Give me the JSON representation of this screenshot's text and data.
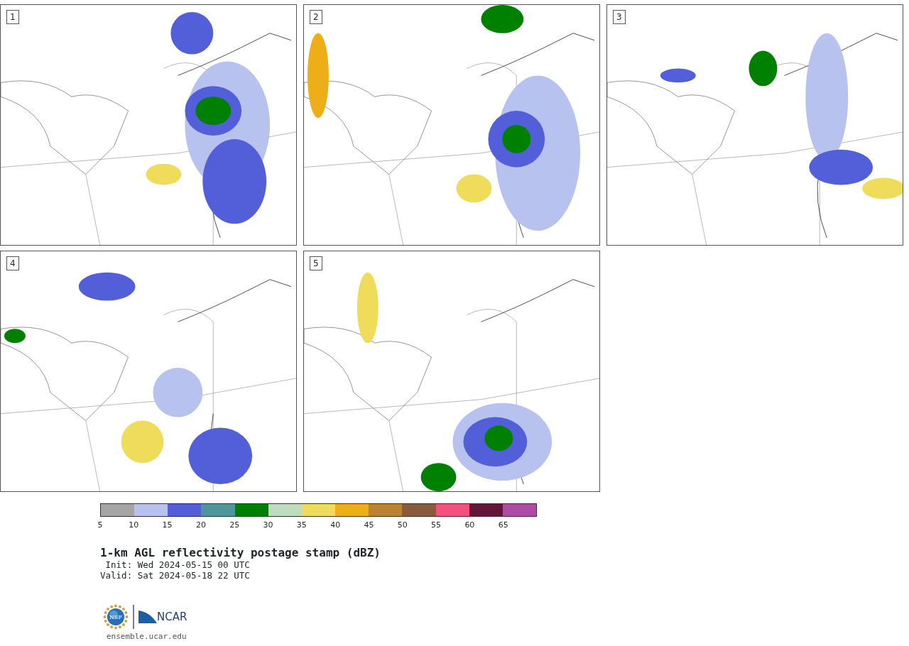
{
  "panels": [
    {
      "number": "1",
      "kind": "map-picture"
    },
    {
      "number": "2",
      "kind": "map-picture"
    },
    {
      "number": "3",
      "kind": "map-picture"
    },
    {
      "number": "4",
      "kind": "map-picture"
    },
    {
      "number": "5",
      "kind": "map-picture"
    }
  ],
  "colorbar": {
    "bins": [
      {
        "color": "#a5a5a5"
      },
      {
        "color": "#b8c2ee"
      },
      {
        "color": "#525fd8"
      },
      {
        "color": "#4f969c"
      },
      {
        "color": "#008000"
      },
      {
        "color": "#bfdcbe"
      },
      {
        "color": "#eedc5a"
      },
      {
        "color": "#eeae17"
      },
      {
        "color": "#bb8330"
      },
      {
        "color": "#8a5a3c"
      },
      {
        "color": "#f5507d"
      },
      {
        "color": "#62173a"
      },
      {
        "color": "#ae4ba7"
      }
    ],
    "ticks": [
      "5",
      "10",
      "15",
      "20",
      "25",
      "30",
      "35",
      "40",
      "45",
      "50",
      "55",
      "60",
      "65"
    ]
  },
  "title": "1-km AGL reflectivity postage stamp (dBZ)",
  "init": " Init: Wed 2024-05-15 00 UTC",
  "valid": "Valid: Sat 2024-05-18 22 UTC",
  "logo": {
    "nsf": "NSF",
    "ncar": "NCAR"
  },
  "url": "ensemble.ucar.edu"
}
